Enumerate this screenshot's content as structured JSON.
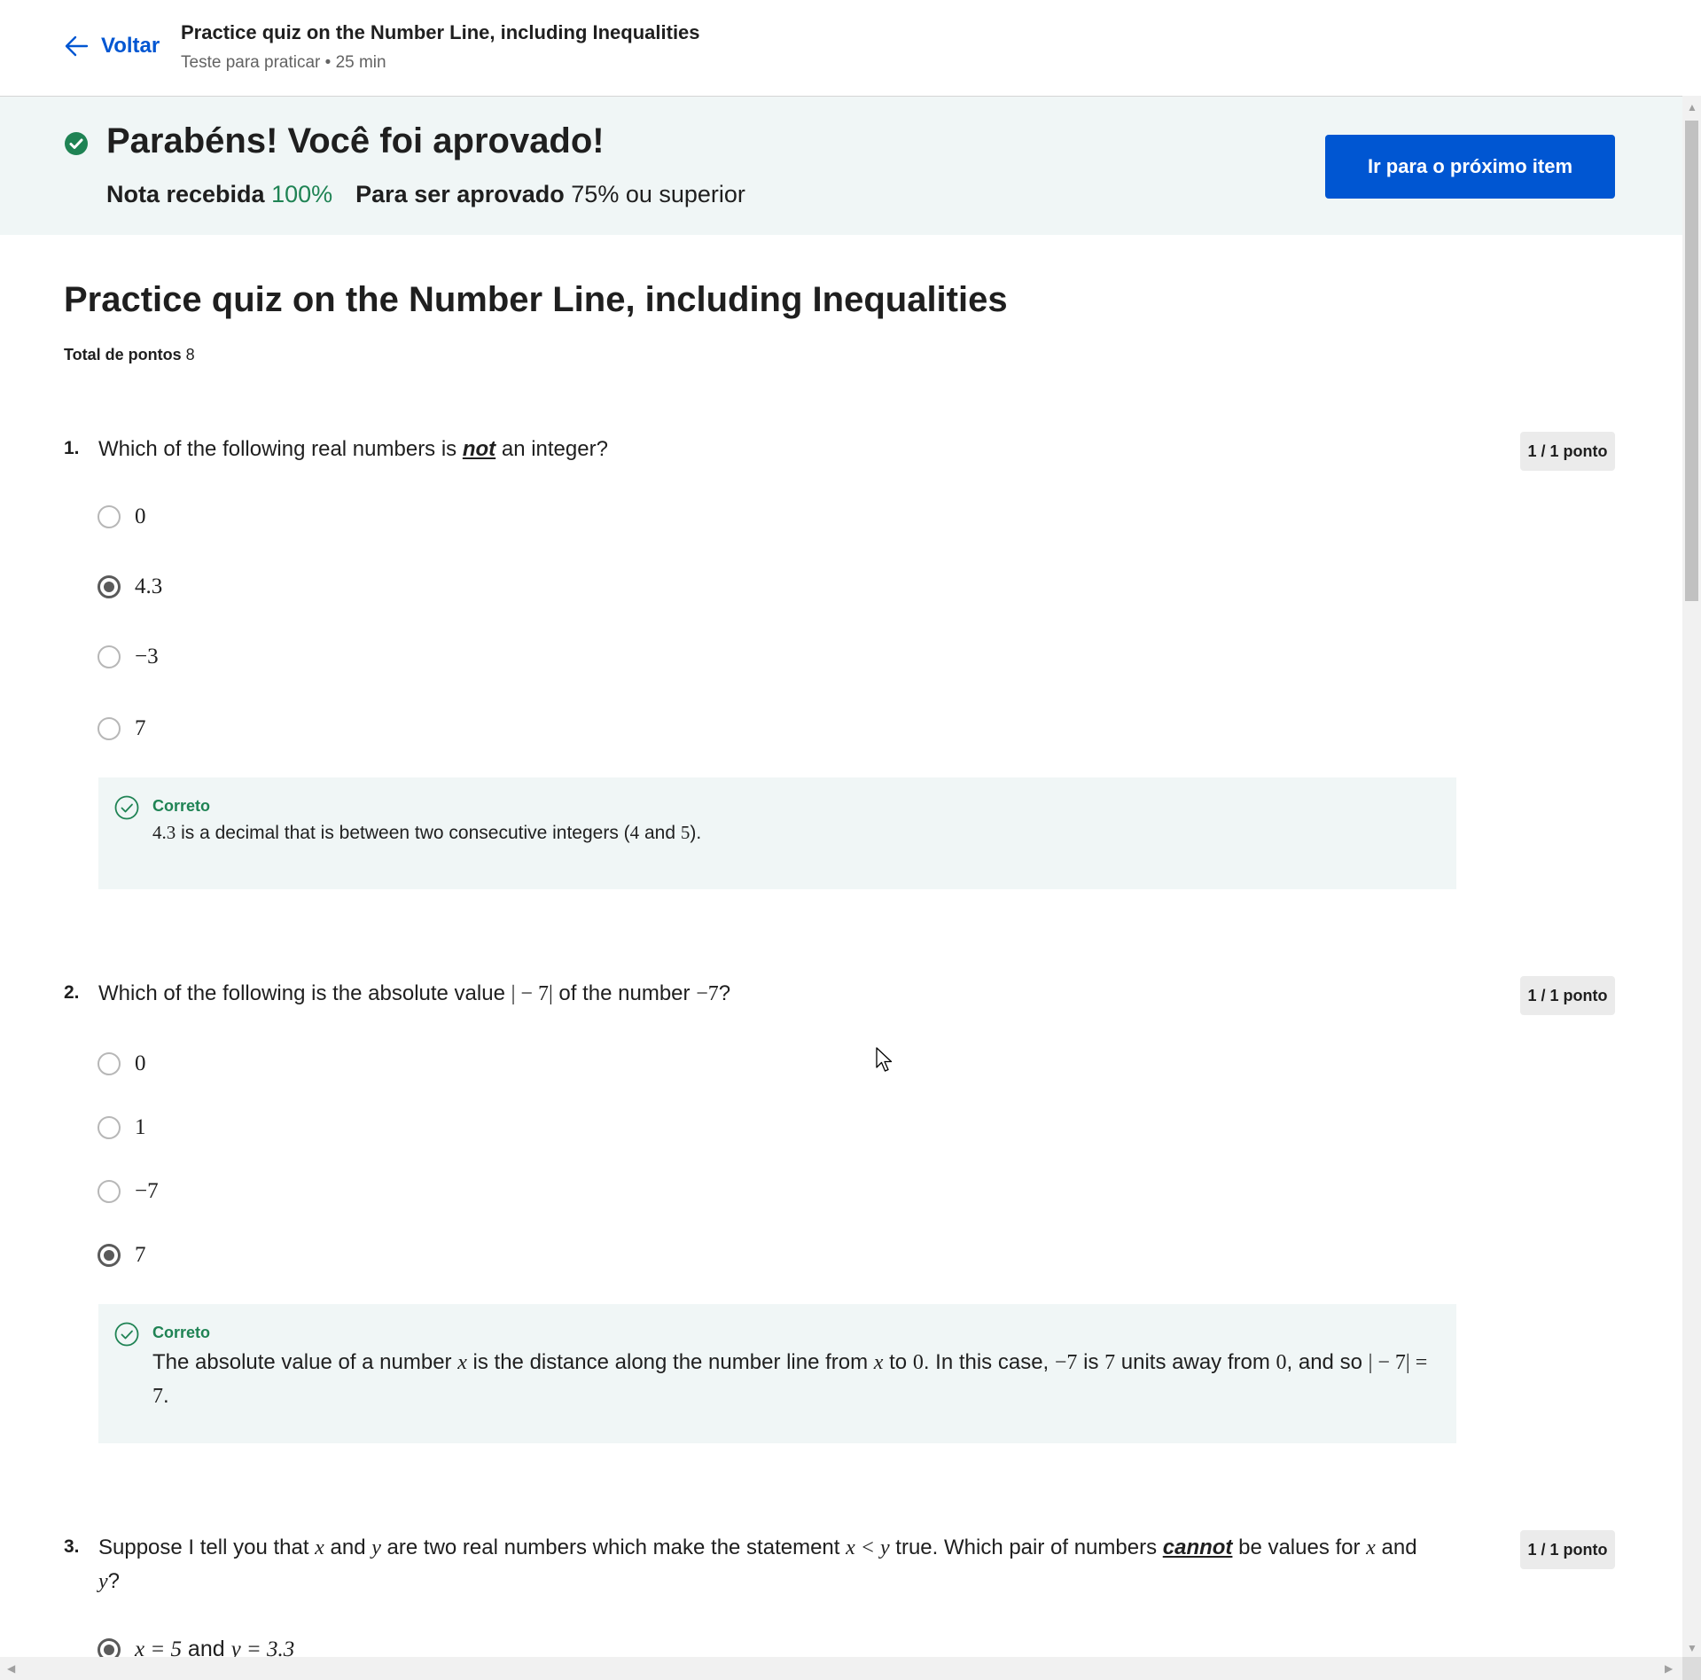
{
  "header": {
    "back_label": "Voltar",
    "title": "Practice quiz on the Number Line, including Inequalities",
    "subtitle": "Teste para praticar • 25 min"
  },
  "banner": {
    "title": "Parabéns! Você foi aprovado!",
    "grade_label": "Nota recebida",
    "grade_value": "100%",
    "pass_label": "Para ser aprovado",
    "pass_value": "75% ou superior",
    "next_button": "Ir para o próximo item"
  },
  "quiz": {
    "title": "Practice quiz on the Number Line, including Inequalities",
    "total_label": "Total de pontos",
    "total_value": "8"
  },
  "questions": [
    {
      "number": "1.",
      "text_before": "Which of the following real numbers is ",
      "text_emph": "not",
      "text_after": " an integer?",
      "points": "1 / 1 ponto",
      "options": [
        "0",
        "4.3",
        "−3",
        "7"
      ],
      "selected_index": 1,
      "feedback_label": "Correto",
      "feedback_math1": "4.3",
      "feedback_text1": " is a decimal that is between two consecutive integers (",
      "feedback_math2": "4",
      "feedback_text2": " and ",
      "feedback_math3": "5",
      "feedback_text3": ")."
    },
    {
      "number": "2.",
      "text_before": "Which of the following is the absolute value ",
      "text_math1": "| − 7|",
      "text_mid": " of the number ",
      "text_math2": "−7",
      "text_after": "?",
      "points": "1 / 1 ponto",
      "options": [
        "0",
        "1",
        "−7",
        "7"
      ],
      "selected_index": 3,
      "feedback_label": "Correto",
      "feedback_parts": [
        "The absolute value of a number ",
        "x",
        " is the distance along the number line from ",
        "x",
        " to ",
        "0",
        ". In this case, ",
        "−7",
        " is ",
        "7",
        " units away from ",
        "0",
        ", and so ",
        "| − 7| = 7",
        "."
      ]
    },
    {
      "number": "3.",
      "text_parts": [
        "Suppose I tell you that ",
        "x",
        " and ",
        "y",
        " are two real numbers which make the statement ",
        "x  < y",
        " true. Which pair of numbers ",
        "cannot",
        " be values for ",
        "x",
        " and ",
        "y",
        "?"
      ],
      "points": "1 / 1 ponto",
      "options": [
        "x = 5 and y = 3.3"
      ],
      "option_parts": [
        "x = 5",
        " and ",
        "y = 3.3"
      ],
      "selected_index": 0
    }
  ],
  "colors": {
    "accent": "#0056d2",
    "success": "#1f8354",
    "banner_bg": "#f0f6f6"
  }
}
